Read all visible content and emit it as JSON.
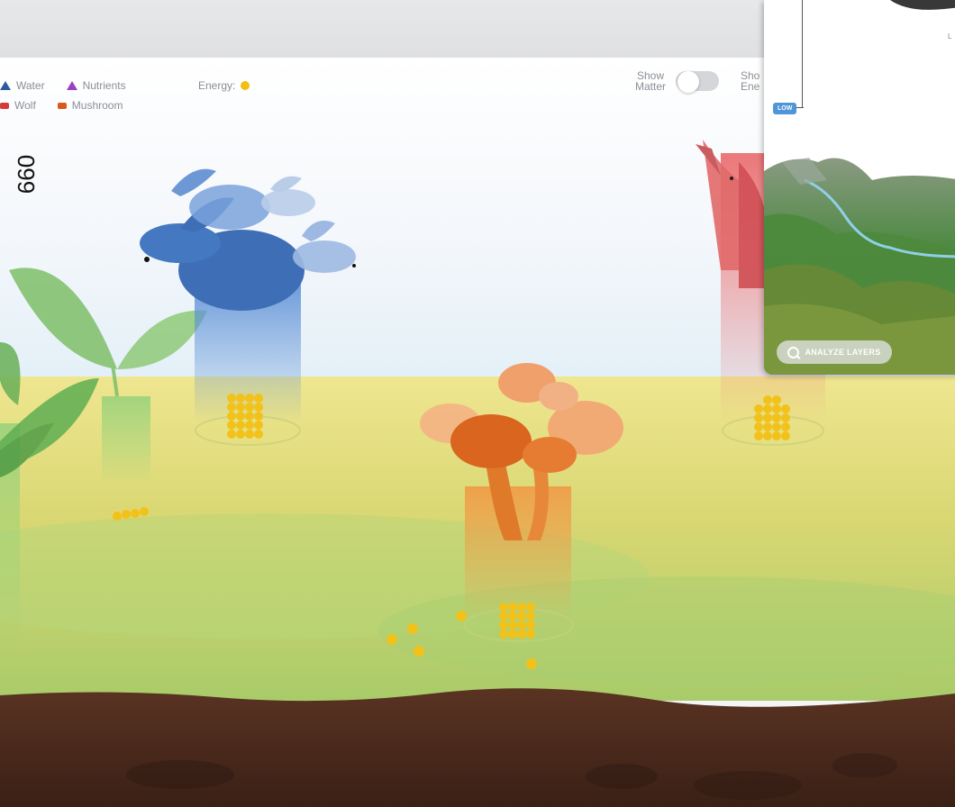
{
  "legend": {
    "row1": [
      {
        "label": "Water",
        "shape": "triangle",
        "color": "#2b5a9f"
      },
      {
        "label": "Nutrients",
        "shape": "triangle",
        "color": "#9b3fc6"
      }
    ],
    "row2": [
      {
        "label": "Wolf",
        "shape": "square",
        "color": "#d43b3b"
      },
      {
        "label": "Mushroom",
        "shape": "square",
        "color": "#d9581b"
      }
    ]
  },
  "energy": {
    "label": "Energy:",
    "color": "#f1bf12"
  },
  "toggles": {
    "show_matter": {
      "line1": "Show",
      "line2": "Matter",
      "on": false
    },
    "show_energy": {
      "line1": "Sho",
      "line2": "Ene"
    }
  },
  "side_label": "660",
  "panel": {
    "low_badge": "LOW",
    "analyze_button": "ANALYZE LAYERS",
    "corner_text": "L"
  },
  "colors": {
    "rabbit": "#3f74be",
    "wolf": "#e0575a",
    "mushroom": "#e8843a",
    "plant": "#7cc06a",
    "soil": "#4a2a1c",
    "ground": "#d7d868"
  }
}
